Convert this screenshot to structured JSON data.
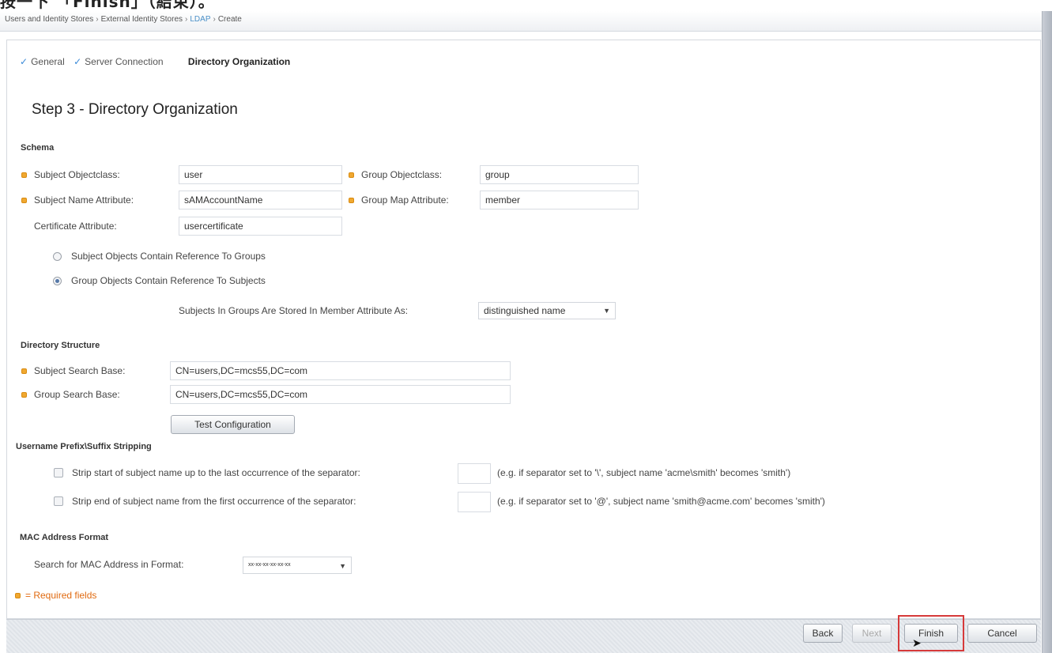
{
  "top_strip": {
    "text": "按一下 「Finish」（結束）。"
  },
  "breadcrumb": {
    "items": [
      "Users and Identity Stores",
      "External Identity Stores",
      "LDAP",
      "Create"
    ],
    "separator": "›"
  },
  "steps": {
    "done": [
      "General",
      "Server Connection"
    ],
    "current": "Directory Organization"
  },
  "page_title": "Step 3 - Directory Organization",
  "schema": {
    "heading": "Schema",
    "subject_objectclass": {
      "label": "Subject Objectclass:",
      "value": "user"
    },
    "subject_name_attribute": {
      "label": "Subject Name Attribute:",
      "value": "sAMAccountName"
    },
    "certificate_attribute": {
      "label": "Certificate Attribute:",
      "value": "usercertificate"
    },
    "group_objectclass": {
      "label": "Group Objectclass:",
      "value": "group"
    },
    "group_map_attribute": {
      "label": "Group Map Attribute:",
      "value": "member"
    },
    "radio_subject_objects": "Subject Objects Contain Reference To Groups",
    "radio_group_objects": "Group Objects Contain Reference To Subjects",
    "member_attr_label": "Subjects In Groups Are Stored In Member Attribute As:",
    "member_attr_value": "distinguished name"
  },
  "directory_structure": {
    "heading": "Directory Structure",
    "subject_search_base": {
      "label": "Subject Search Base:",
      "value": "CN=users,DC=mcs55,DC=com"
    },
    "group_search_base": {
      "label": "Group Search Base:",
      "value": "CN=users,DC=mcs55,DC=com"
    },
    "test_button": "Test Configuration"
  },
  "stripping": {
    "heading": "Username Prefix\\Suffix Stripping",
    "start": {
      "label": "Strip start of subject name up to the last occurrence of the separator:",
      "example": "(e.g. if separator set to '\\', subject name 'acme\\smith' becomes 'smith')"
    },
    "end": {
      "label": "Strip end of subject name from the first occurrence of the separator:",
      "example": "(e.g. if separator set to '@', subject name 'smith@acme.com' becomes 'smith')"
    }
  },
  "mac": {
    "heading": "MAC Address Format",
    "label": "Search for MAC Address in Format:",
    "value": "xx-xx-xx-xx-xx-xx"
  },
  "required_note": "= Required fields",
  "buttons": {
    "back": "Back",
    "next": "Next",
    "finish": "Finish",
    "cancel": "Cancel"
  },
  "colors": {
    "accent": "#3a8ad8",
    "required": "#f0a830",
    "highlight": "#d63a3a"
  }
}
